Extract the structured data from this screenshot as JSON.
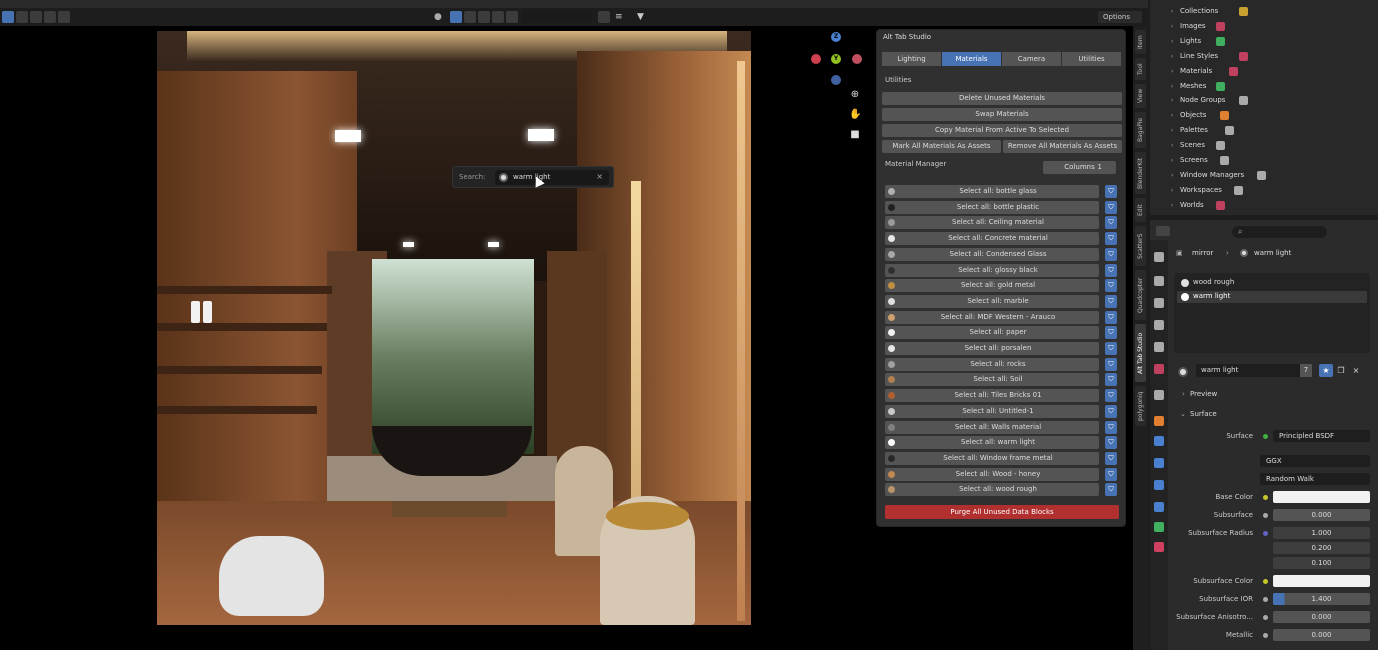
{
  "header": {
    "options_label": "Options"
  },
  "viewport": {
    "search": {
      "label": "Search:",
      "value": "warm light"
    }
  },
  "alt_tab_panel": {
    "title": "Alt Tab Studio",
    "tabs": [
      "Lighting",
      "Materials",
      "Camera",
      "Utilities"
    ],
    "active_tab": "Materials",
    "utilities_heading": "Utilities",
    "buttons": {
      "delete_unused": "Delete Unused Materials",
      "swap": "Swap Materials",
      "copy_material": "Copy Material From Active To Selected",
      "mark_all": "Mark All Materials As Assets",
      "remove_all": "Remove All Materials As Assets"
    },
    "material_manager_label": "Material Manager",
    "columns_label": "Columns",
    "columns_value": "1",
    "materials": [
      {
        "label": "Select all: bottle glass",
        "color": "#b0b0b0"
      },
      {
        "label": "Select all: bottle plastic",
        "color": "#202020"
      },
      {
        "label": "Select all: Ceiling material",
        "color": "#9a9a9a"
      },
      {
        "label": "Select all: Concrete material",
        "color": "#e8e8e8"
      },
      {
        "label": "Select all: Condensed Glass",
        "color": "#a8a8a8"
      },
      {
        "label": "Select all: glossy black",
        "color": "#303030"
      },
      {
        "label": "Select all: gold metal",
        "color": "#c09040"
      },
      {
        "label": "Select all: marble",
        "color": "#e0e0e0"
      },
      {
        "label": "Select all: MDF Western - Arauco",
        "color": "#d0a070"
      },
      {
        "label": "Select all: paper",
        "color": "#f0f0f0"
      },
      {
        "label": "Select all: porsalen",
        "color": "#e6e6e6"
      },
      {
        "label": "Select all: rocks",
        "color": "#a0a0a0"
      },
      {
        "label": "Select all: Soil",
        "color": "#b08050"
      },
      {
        "label": "Select all: Tiles Bricks 01",
        "color": "#b06030"
      },
      {
        "label": "Select all: Untitled-1",
        "color": "#c8c8c8"
      },
      {
        "label": "Select all: Walls material",
        "color": "#808080"
      },
      {
        "label": "Select all: warm light",
        "color": "#ffffff"
      },
      {
        "label": "Select all: Window frame metal",
        "color": "#282828"
      },
      {
        "label": "Select all: Wood - honey",
        "color": "#c08a50"
      },
      {
        "label": "Select all: wood rough",
        "color": "#b8956a"
      }
    ],
    "purge_label": "Purge All Unused Data Blocks"
  },
  "vertical_tabs": [
    "Item",
    "Tool",
    "View",
    "BagaPie",
    "BlenderKit",
    "Edit",
    "ScatterS",
    "Quadcopter",
    "Alt Tab Studio",
    "polygoniq"
  ],
  "outliner": {
    "items": [
      "Collections",
      "Images",
      "Lights",
      "Line Styles",
      "Materials",
      "Meshes",
      "Node Groups",
      "Objects",
      "Palettes",
      "Scenes",
      "Screens",
      "Window Managers",
      "Workspaces",
      "Worlds"
    ]
  },
  "properties": {
    "breadcrumb_object": "mirror",
    "breadcrumb_material": "warm light",
    "slots": [
      "wood rough",
      "warm light"
    ],
    "material_name": "warm light",
    "users": "7",
    "sections": {
      "preview": "Preview",
      "surface": "Surface"
    },
    "surface_label": "Surface",
    "surface_shader": "Principled BSDF",
    "distribution": "GGX",
    "subsurface_method": "Random Walk",
    "fields": [
      {
        "label": "Base Color",
        "value": ""
      },
      {
        "label": "Subsurface",
        "value": "0.000"
      },
      {
        "label": "Subsurface Radius",
        "value": "1.000"
      },
      {
        "label": "",
        "value": "0.200"
      },
      {
        "label": "",
        "value": "0.100"
      },
      {
        "label": "Subsurface Color",
        "value": ""
      },
      {
        "label": "Subsurface IOR",
        "value": "1.400"
      },
      {
        "label": "Subsurface Anisotro...",
        "value": "0.000"
      },
      {
        "label": "Metallic",
        "value": "0.000"
      }
    ]
  },
  "colors": {
    "accent": "#4772b3",
    "purge": "#b03030",
    "panel": "#303030"
  }
}
